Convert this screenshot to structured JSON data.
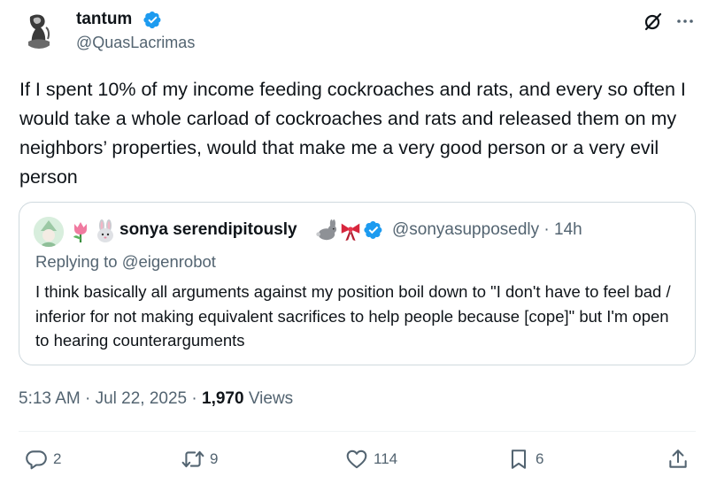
{
  "author": {
    "name": "tantum",
    "handle": "@QuasLacrimas"
  },
  "icons": {
    "verified": "verified-badge-icon",
    "grok": "grok-icon",
    "more": "more-options-icon",
    "reply": "reply-icon",
    "repost": "repost-icon",
    "like": "like-icon",
    "bookmark": "bookmark-icon",
    "share": "share-icon"
  },
  "colors": {
    "verified": "#1d9bf0",
    "text": "#0f1419",
    "secondary": "#536471",
    "border": "#cfd9de"
  },
  "tweet": {
    "text": "If I spent 10% of my income feeding cockroaches and rats, and every so often I would take a whole carload of cockroaches and rats and released them on my neighbors’ properties, would that make me a very good person or a very evil person"
  },
  "quote": {
    "author_emojis": [
      "🌷",
      "🐰"
    ],
    "name": "sonya serendipitously",
    "name_emojis": [
      "🐇",
      "🎀"
    ],
    "handle_time": "@sonyasupposedly · 14h",
    "replying_to": "Replying to @eigenrobot",
    "text": "I think basically all arguments against my position boil down to \"I don't have to feel bad / inferior for not making equivalent sacrifices to help people because [cope]\" but I'm open to hearing counterarguments"
  },
  "meta": {
    "timestamp": "5:13 AM · Jul 22, 2025 · ",
    "views_count": "1,970",
    "views_label": " Views"
  },
  "actions": {
    "replies": "2",
    "reposts": "9",
    "likes": "114",
    "bookmarks": "6"
  }
}
